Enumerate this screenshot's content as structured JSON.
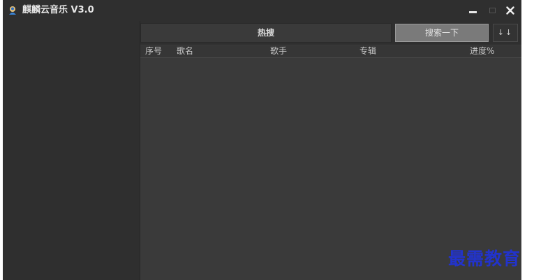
{
  "app": {
    "title": "麒麟云音乐 V3.0",
    "icon": "app-logo-icon"
  },
  "window_controls": {
    "minimize_icon": "minimize-icon",
    "maximize_icon": "maximize-icon",
    "close_icon": "close-icon",
    "close_glyph": "✕"
  },
  "toolbar": {
    "hot_search_label": "热搜",
    "search_button_label": "搜索一下",
    "sort_button_label": "↓↓"
  },
  "table": {
    "columns": {
      "index": "序号",
      "song": "歌名",
      "artist": "歌手",
      "album": "专辑",
      "progress": "进度%"
    },
    "rows": []
  },
  "watermark": {
    "text": "最需教育"
  },
  "colors": {
    "window_bg": "#2f2f2f",
    "main_bg": "#3a3a3a",
    "search_button_bg": "#7a7a7a",
    "watermark": "#2233cc"
  }
}
